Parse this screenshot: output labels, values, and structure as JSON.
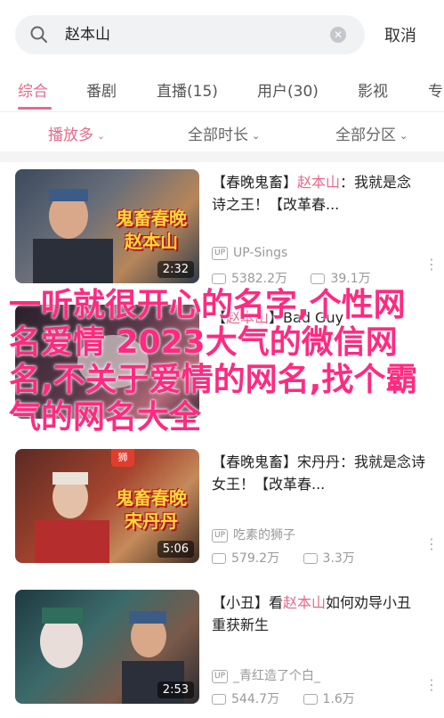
{
  "search": {
    "query": "赵本山",
    "cancel_label": "取消"
  },
  "tabs": [
    {
      "label": "综合"
    },
    {
      "label": "番剧"
    },
    {
      "label": "直播(15)"
    },
    {
      "label": "用户(30)"
    },
    {
      "label": "影视"
    },
    {
      "label": "专"
    }
  ],
  "filters": [
    {
      "label": "播放多"
    },
    {
      "label": "全部时长"
    },
    {
      "label": "全部分区"
    }
  ],
  "videos": [
    {
      "thumb_caption": "鬼畜春晚\n赵本山",
      "badge": "",
      "duration": "2:32",
      "title_pre": "【春晚鬼畜】",
      "title_hl": "赵本山",
      "title_post": "：我就是念诗之王！【改革春...",
      "uploader": "UP-Sings",
      "views": "5382.2万",
      "danmaku": "39.1万"
    },
    {
      "thumb_caption": "",
      "badge": "",
      "duration": "",
      "title_pre": "【",
      "title_hl": "赵本山",
      "title_post": "】Bad Guy",
      "uploader": "",
      "views": "",
      "danmaku": ""
    },
    {
      "thumb_caption": "鬼畜春晚\n宋丹丹",
      "badge": "狮",
      "duration": "5:06",
      "title_pre": "【春晚鬼畜】宋丹丹：我就是念诗女王！【改革春...",
      "title_hl": "",
      "title_post": "",
      "uploader": "吃素的狮子",
      "views": "579.2万",
      "danmaku": "3.3万"
    },
    {
      "thumb_caption": "",
      "badge": "",
      "duration": "2:53",
      "title_pre": "【小丑】看",
      "title_hl": "赵本山",
      "title_post": "如何劝导小丑重获新生",
      "uploader": "_青红造了个白_",
      "views": "544.7万",
      "danmaku": "1.6万"
    }
  ],
  "overlay": "一听就很开心的名字,个性网名爱情 2023大气的微信网名,不关于爱情的网名,找个霸气的网名大全",
  "colors": {
    "accent": "#e56a8b",
    "overlay": "#ff2a80"
  }
}
